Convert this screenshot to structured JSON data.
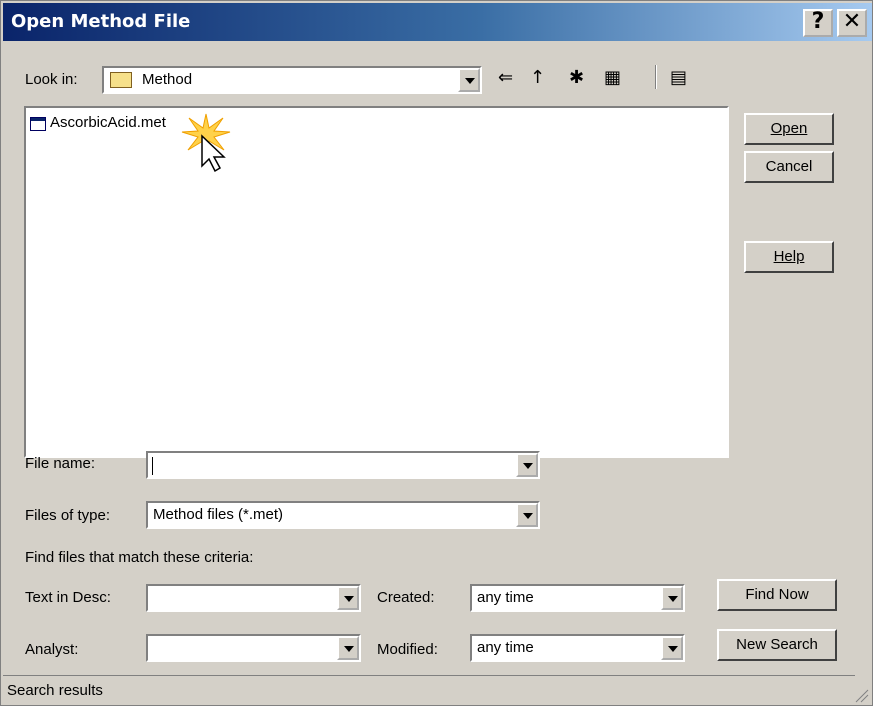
{
  "window": {
    "title": "Open Method File",
    "help_glyph": "?",
    "close_glyph": "✕"
  },
  "look_in": {
    "label": "Look in:",
    "value": "Method"
  },
  "toolbar": {
    "back": "⇐",
    "up_folder": "↑",
    "new_folder": "✱",
    "view_menu": "▦",
    "details": "▤"
  },
  "files": [
    {
      "name": "AscorbicAcid.met"
    }
  ],
  "buttons": {
    "open": "Open",
    "cancel": "Cancel",
    "help": "Help",
    "find_now": "Find Now",
    "new_search": "New Search"
  },
  "file_name": {
    "label": "File name:",
    "value": ""
  },
  "files_of_type": {
    "label": "Files of type:",
    "value": "Method files (*.met)"
  },
  "criteria": {
    "heading": "Find files that match these criteria:",
    "text_in_desc": {
      "label": "Text in Desc:",
      "value": ""
    },
    "analyst": {
      "label": "Analyst:",
      "value": ""
    },
    "created": {
      "label": "Created:",
      "value": "any time"
    },
    "modified": {
      "label": "Modified:",
      "value": "any time"
    }
  },
  "status": {
    "text": "Search results"
  }
}
